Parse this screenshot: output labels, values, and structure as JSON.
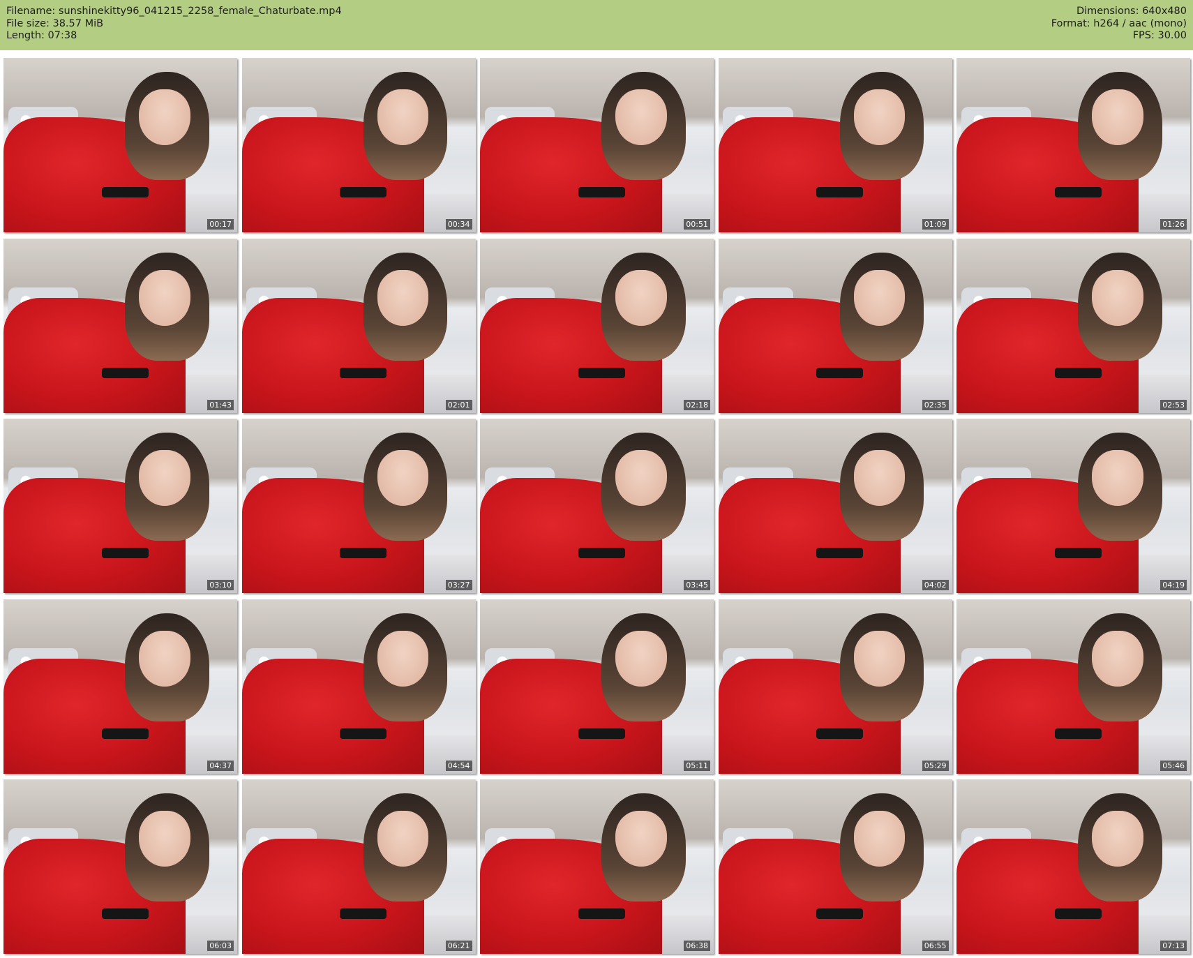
{
  "header": {
    "filename_label": "Filename:",
    "filename": "sunshinekitty96_041215_2258_female_Chaturbate.mp4",
    "filesize_label": "File size:",
    "filesize": "38.57 MiB",
    "length_label": "Length:",
    "length": "07:38",
    "dimensions_label": "Dimensions:",
    "dimensions": "640x480",
    "format_label": "Format:",
    "format": "h264 / aac (mono)",
    "fps_label": "FPS:",
    "fps": "30.00",
    "background_color": "#b3ce82"
  },
  "thumbnails": [
    {
      "timestamp": "00:17"
    },
    {
      "timestamp": "00:34"
    },
    {
      "timestamp": "00:51"
    },
    {
      "timestamp": "01:09"
    },
    {
      "timestamp": "01:26"
    },
    {
      "timestamp": "01:43"
    },
    {
      "timestamp": "02:01"
    },
    {
      "timestamp": "02:18"
    },
    {
      "timestamp": "02:35"
    },
    {
      "timestamp": "02:53"
    },
    {
      "timestamp": "03:10"
    },
    {
      "timestamp": "03:27"
    },
    {
      "timestamp": "03:45"
    },
    {
      "timestamp": "04:02"
    },
    {
      "timestamp": "04:19"
    },
    {
      "timestamp": "04:37"
    },
    {
      "timestamp": "04:54"
    },
    {
      "timestamp": "05:11"
    },
    {
      "timestamp": "05:29"
    },
    {
      "timestamp": "05:46"
    },
    {
      "timestamp": "06:03"
    },
    {
      "timestamp": "06:21"
    },
    {
      "timestamp": "06:38"
    },
    {
      "timestamp": "06:55"
    },
    {
      "timestamp": "07:13"
    }
  ]
}
